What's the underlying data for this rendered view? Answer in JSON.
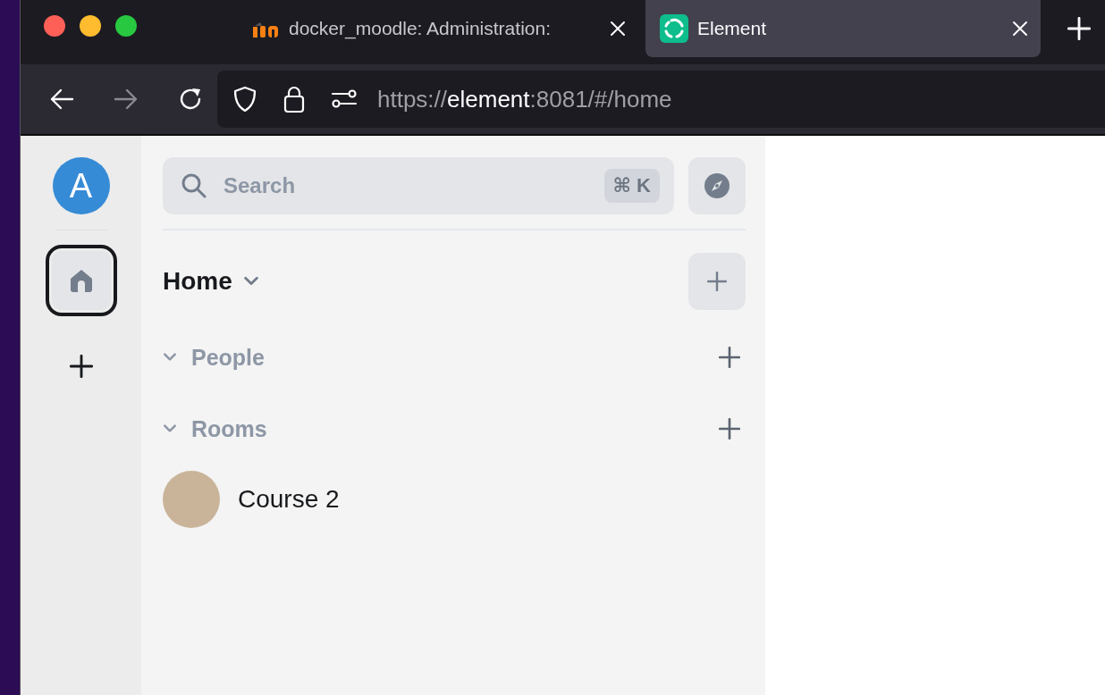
{
  "browser": {
    "tabs": [
      {
        "title": "docker_moodle: Administration:",
        "kind": "moodle",
        "selected": false
      },
      {
        "title": "Element",
        "kind": "element",
        "selected": true
      }
    ],
    "nav": [
      {
        "kind": "back",
        "disabled": false
      },
      {
        "kind": "forward",
        "disabled": true
      },
      {
        "kind": "reload",
        "disabled": false
      }
    ],
    "url": {
      "scheme": "https://",
      "host": "element",
      "rest": ":8081/#/home"
    }
  },
  "spaces": {
    "avatar_letter": "A",
    "items": [
      {
        "kind": "home",
        "selected": true
      },
      {
        "kind": "create",
        "selected": false
      }
    ]
  },
  "room_list": {
    "search": {
      "placeholder": "Search",
      "shortcut": "⌘ K"
    },
    "title": "Home",
    "sections": [
      {
        "name": "People",
        "expanded": true
      },
      {
        "name": "Rooms",
        "expanded": true,
        "rooms": [
          {
            "name": "Course 2"
          }
        ]
      }
    ]
  }
}
